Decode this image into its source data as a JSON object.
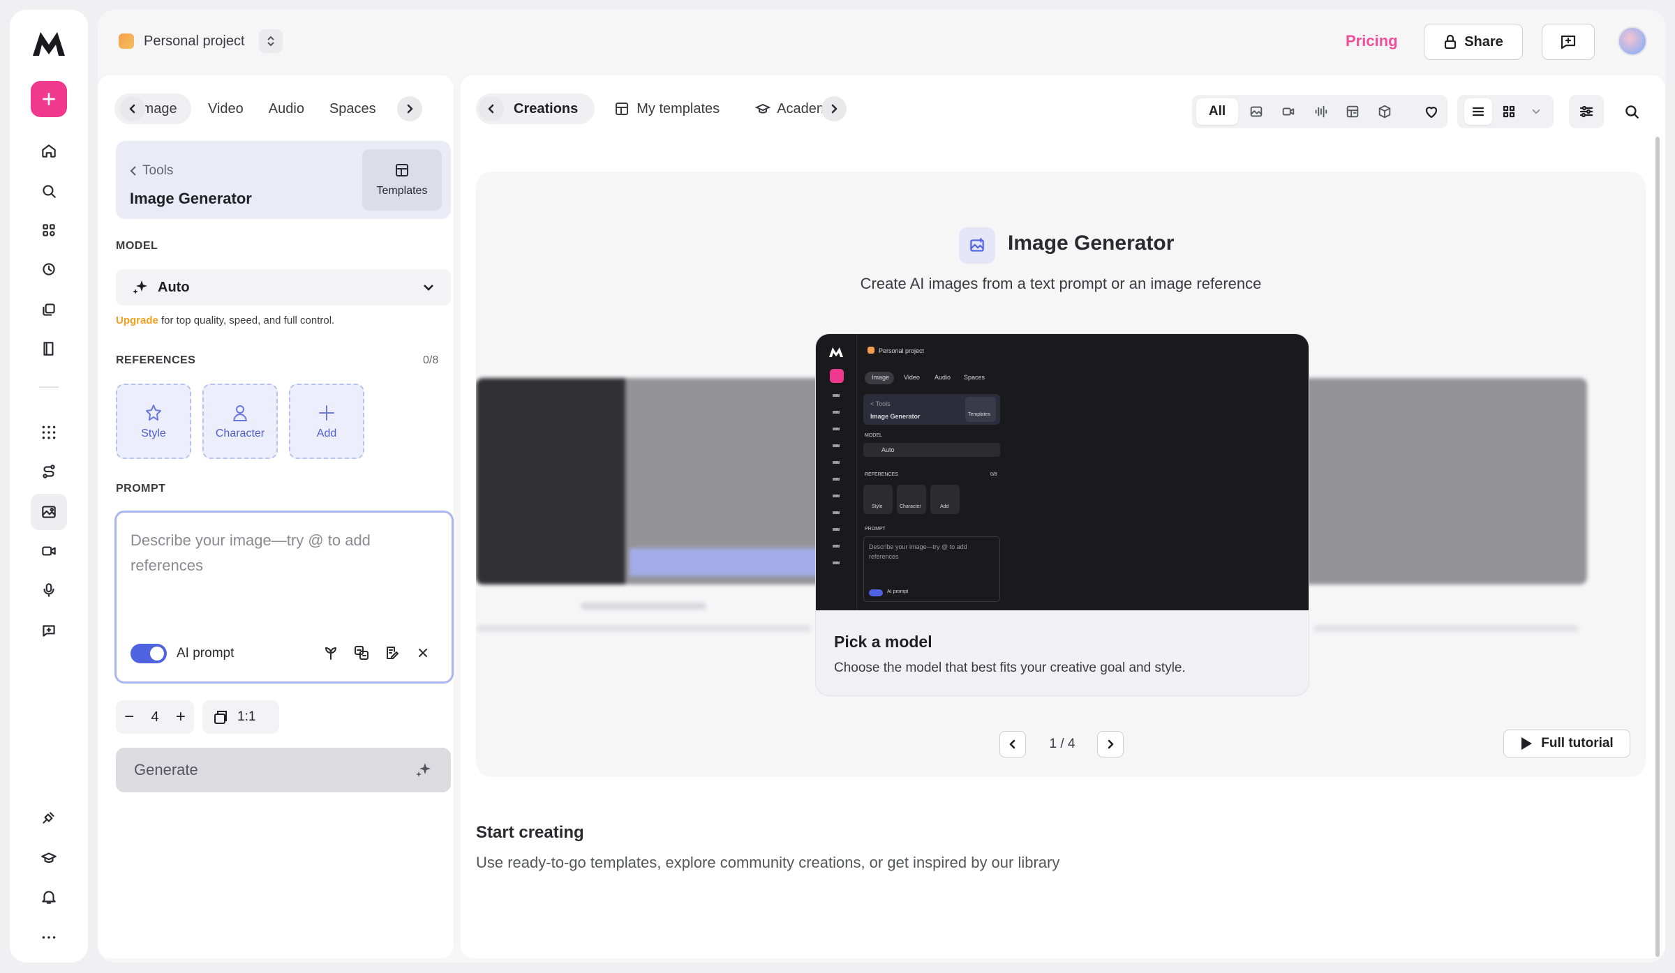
{
  "header": {
    "project_name": "Personal project",
    "pricing_label": "Pricing",
    "share_label": "Share"
  },
  "rail": {
    "items": [
      "new-plus",
      "home",
      "search",
      "apps",
      "history",
      "layers",
      "library",
      "grid",
      "workflow",
      "image-generator",
      "video",
      "audio",
      "feedback",
      "plugin",
      "academy",
      "notifications",
      "more"
    ]
  },
  "left_panel": {
    "tabs": [
      "Image",
      "Video",
      "Audio",
      "Spaces"
    ],
    "tool": {
      "back_label": "Tools",
      "title": "Image Generator",
      "templates_label": "Templates"
    },
    "model": {
      "section_label": "MODEL",
      "selected": "Auto",
      "upgrade_link": "Upgrade",
      "upgrade_text": " for top quality, speed, and full control."
    },
    "references": {
      "section_label": "REFERENCES",
      "count": "0/8",
      "slots": [
        "Style",
        "Character",
        "Add"
      ]
    },
    "prompt": {
      "section_label": "PROMPT",
      "placeholder": "Describe your image—try @ to add references",
      "ai_prompt_label": "AI prompt",
      "ai_prompt_enabled": true
    },
    "count_value": "4",
    "ratio_value": "1:1",
    "generate_label": "Generate"
  },
  "right_panel": {
    "tabs": [
      "Creations",
      "My templates",
      "Academy"
    ],
    "filter_all_label": "All",
    "hero": {
      "title": "Image Generator",
      "subtitle": "Create AI images from a text prompt or an image reference",
      "card_title": "Pick a model",
      "card_desc": "Choose the model that best fits your creative goal and style.",
      "pager": "1 / 4",
      "tutorial_label": "Full tutorial"
    },
    "start_title": "Start creating",
    "start_sub": "Use ready-to-go templates, explore community creations, or get inspired by our library"
  },
  "mini_preview": {
    "project": "Personal project",
    "tabs": [
      "Image",
      "Video",
      "Audio",
      "Spaces"
    ],
    "tools": "< Tools",
    "title": "Image Generator",
    "templates": "Templates",
    "model_label": "MODEL",
    "model_value": "Auto",
    "refs_label": "REFERENCES",
    "refs_count": "0/8",
    "ref_slots": [
      "Style",
      "Character",
      "Add"
    ],
    "prompt_label": "PROMPT",
    "prompt_placeholder": "Describe your image—try @ to add references",
    "ai_prompt": "AI prompt"
  },
  "colors": {
    "brand_pink": "#f0388f",
    "pricing": "#ef4f9a",
    "accent_blue": "#4f63e0",
    "upgrade": "#f0a020"
  }
}
